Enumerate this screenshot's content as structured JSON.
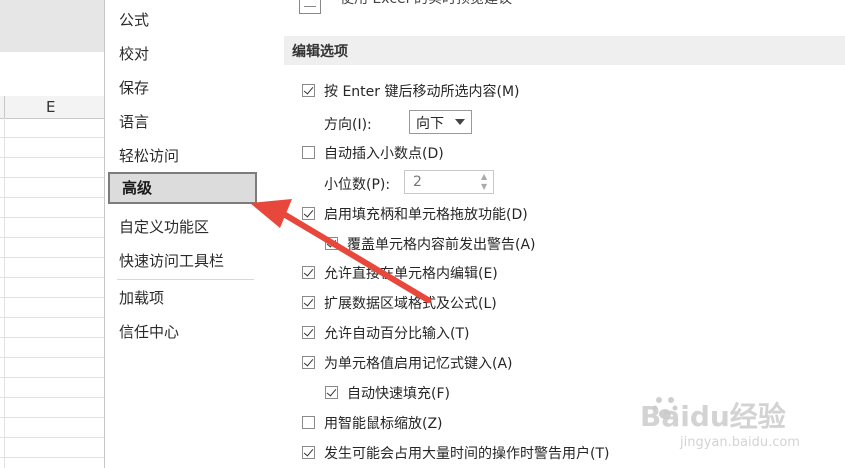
{
  "sheet": {
    "column_letter": "E"
  },
  "nav": {
    "items": [
      {
        "label": "公式"
      },
      {
        "label": "校对"
      },
      {
        "label": "保存"
      },
      {
        "label": "语言"
      },
      {
        "label": "轻松访问"
      },
      {
        "label": "高级",
        "selected": true
      },
      {
        "label": "自定义功能区"
      },
      {
        "label": "快速访问工具栏"
      },
      {
        "label": "加载项"
      },
      {
        "label": "信任中心"
      }
    ]
  },
  "content": {
    "top_partial_text": "使用 Excel 的实时预览建议",
    "section_title": "编辑选项",
    "options": [
      {
        "label": "按 Enter 键后移动所选内容(M)",
        "checked": true
      },
      {
        "label": "方向(I):",
        "control": "select",
        "value": "向下"
      },
      {
        "label": "自动插入小数点(D)",
        "checked": false
      },
      {
        "label": "小位数(P):",
        "control": "spin",
        "value": "2"
      },
      {
        "label": "启用填充柄和单元格拖放功能(D)",
        "checked": true
      },
      {
        "label": "覆盖单元格内容前发出警告(A)",
        "checked": true
      },
      {
        "label": "允许直接在单元格内编辑(E)",
        "checked": true
      },
      {
        "label": "扩展数据区域格式及公式(L)",
        "checked": true
      },
      {
        "label": "允许自动百分比输入(T)",
        "checked": true
      },
      {
        "label": "为单元格值启用记忆式键入(A)",
        "checked": true
      },
      {
        "label": "自动快速填充(F)",
        "checked": true
      },
      {
        "label": "用智能鼠标缩放(Z)",
        "checked": false
      },
      {
        "label": "发生可能会占用大量时间的操作时警告用户(T)",
        "checked": true
      }
    ]
  },
  "annotation": {
    "arrow_color": "#e8473b"
  },
  "watermark": {
    "text": "Baidu经验",
    "url": "jingyan.baidu.com"
  }
}
